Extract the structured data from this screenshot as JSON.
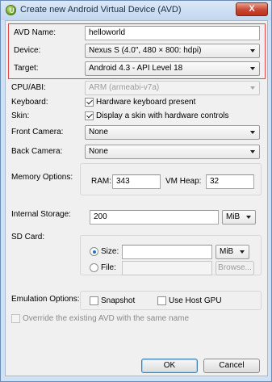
{
  "window": {
    "title": "Create new Android Virtual Device (AVD)",
    "close_label": "X"
  },
  "form": {
    "avd_name": {
      "label": "AVD Name:",
      "value": "helloworld"
    },
    "device": {
      "label": "Device:",
      "value": "Nexus S (4.0\", 480 × 800: hdpi)"
    },
    "target": {
      "label": "Target:",
      "value": "Android 4.3 - API Level 18"
    },
    "cpu_abi": {
      "label": "CPU/ABI:",
      "value": "ARM (armeabi-v7a)"
    },
    "keyboard": {
      "label": "Keyboard:",
      "option": "Hardware keyboard present",
      "checked": true
    },
    "skin": {
      "label": "Skin:",
      "option": "Display a skin with hardware controls",
      "checked": true
    },
    "front_camera": {
      "label": "Front Camera:",
      "value": "None"
    },
    "back_camera": {
      "label": "Back Camera:",
      "value": "None"
    },
    "memory": {
      "label": "Memory Options:",
      "ram_label": "RAM:",
      "ram_value": "343",
      "heap_label": "VM Heap:",
      "heap_value": "32"
    },
    "internal_storage": {
      "label": "Internal Storage:",
      "value": "200",
      "unit": "MiB"
    },
    "sd_card": {
      "label": "SD Card:",
      "size_label": "Size:",
      "size_value": "",
      "size_unit": "MiB",
      "file_label": "File:",
      "file_value": "",
      "browse_label": "Browse...",
      "selected": "size"
    },
    "emulation": {
      "label": "Emulation Options:",
      "snapshot": "Snapshot",
      "snapshot_checked": false,
      "host_gpu": "Use Host GPU",
      "host_gpu_checked": false
    },
    "override": {
      "label": "Override the existing AVD with the same name",
      "checked": false
    }
  },
  "buttons": {
    "ok": "OK",
    "cancel": "Cancel"
  },
  "colors": {
    "highlight_border": "#e0474c",
    "title_bar": "#c2d7ef"
  }
}
